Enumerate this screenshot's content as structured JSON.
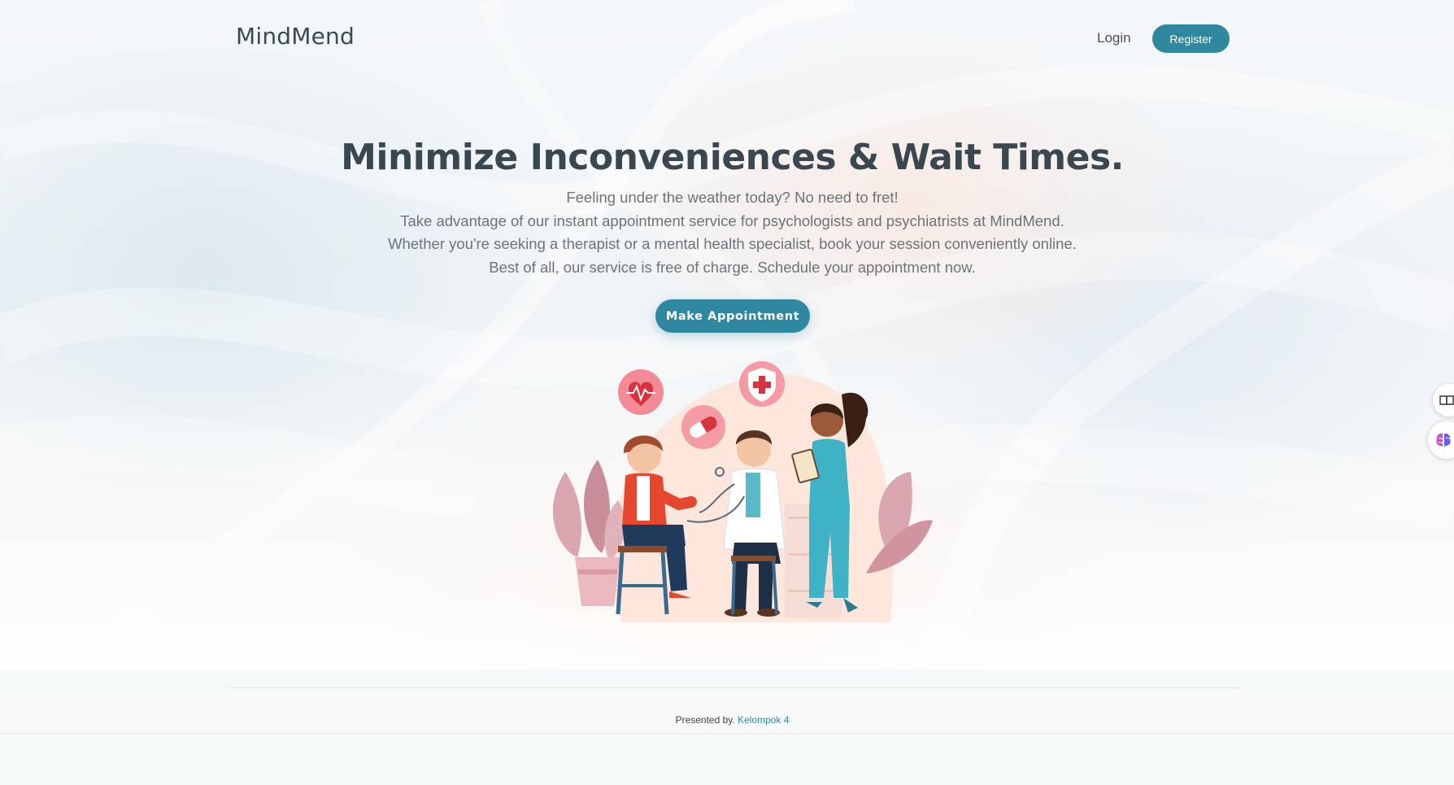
{
  "nav": {
    "brand": "MindMend",
    "login_label": "Login",
    "register_label": "Register"
  },
  "hero": {
    "title": "Minimize Inconveniences & Wait Times.",
    "lines": [
      "Feeling under the weather today? No need to fret!",
      "Take advantage of our instant appointment service for psychologists and psychiatrists at MindMend.",
      "Whether you're seeking a therapist or a mental health specialist, book your session conveniently online.",
      "Best of all, our service is free of charge. Schedule your appointment now."
    ],
    "cta_label": "Make Appointment",
    "illustration_icon": "doctor-patient-illustration"
  },
  "footer": {
    "presented_by": "Presented by.",
    "link_label": "Kelompok 4"
  },
  "side_tabs": [
    {
      "icon": "book-icon"
    },
    {
      "icon": "brain-icon"
    }
  ],
  "colors": {
    "accent": "#2f87a0",
    "heading": "#3b4750",
    "body_text": "#6d7378"
  }
}
